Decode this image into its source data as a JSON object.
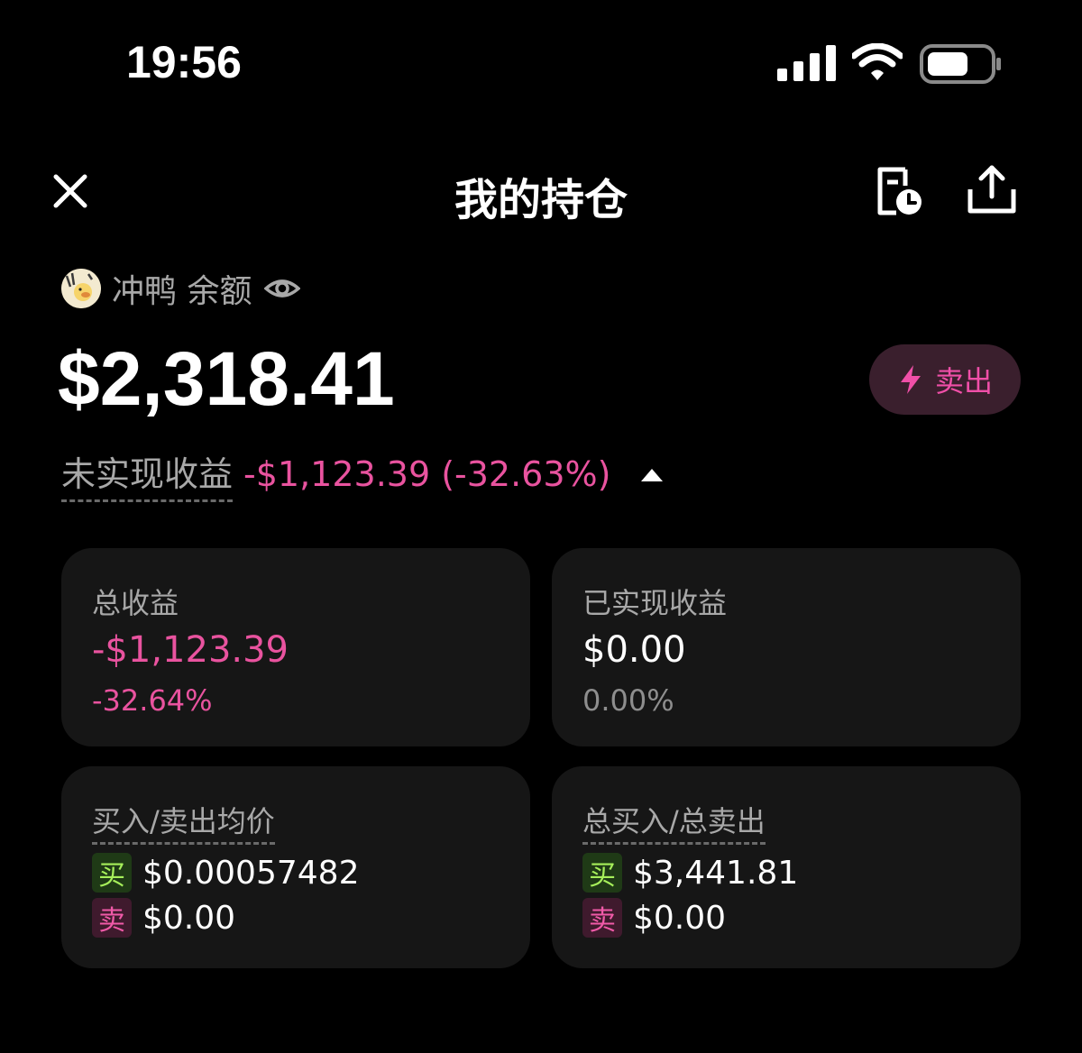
{
  "status_bar": {
    "time": "19:56"
  },
  "header": {
    "title": "我的持仓",
    "close_icon": "close-icon",
    "history_icon": "document-clock-icon",
    "share_icon": "share-upload-icon"
  },
  "token": {
    "name": "冲鸭 余额",
    "avatar_icon": "token-avatar",
    "visibility_icon": "eye-icon"
  },
  "balance": {
    "value": "$2,318.41"
  },
  "sell_button": {
    "label": "卖出",
    "icon": "lightning-bolt-icon"
  },
  "unrealized": {
    "label": "未实现收益",
    "value": "-$1,123.39 (-32.63%)",
    "toggle_icon": "caret-up-icon"
  },
  "cards": {
    "total_pnl": {
      "label": "总收益",
      "value": "-$1,123.39",
      "percent": "-32.64%"
    },
    "realized_pnl": {
      "label": "已实现收益",
      "value": "$0.00",
      "percent": "0.00%"
    },
    "avg_price": {
      "label": "买入/卖出均价",
      "buy_tag": "买",
      "buy_value": "$0.00057482",
      "sell_tag": "卖",
      "sell_value": "$0.00"
    },
    "totals": {
      "label": "总买入/总卖出",
      "buy_tag": "买",
      "buy_value": "$3,441.81",
      "sell_tag": "卖",
      "sell_value": "$0.00"
    }
  },
  "colors": {
    "background": "#000000",
    "card": "#161616",
    "negative": "#e9539f",
    "buy": "#a6ef5a",
    "sell": "#f05aa8",
    "muted": "#a8a8a8"
  }
}
